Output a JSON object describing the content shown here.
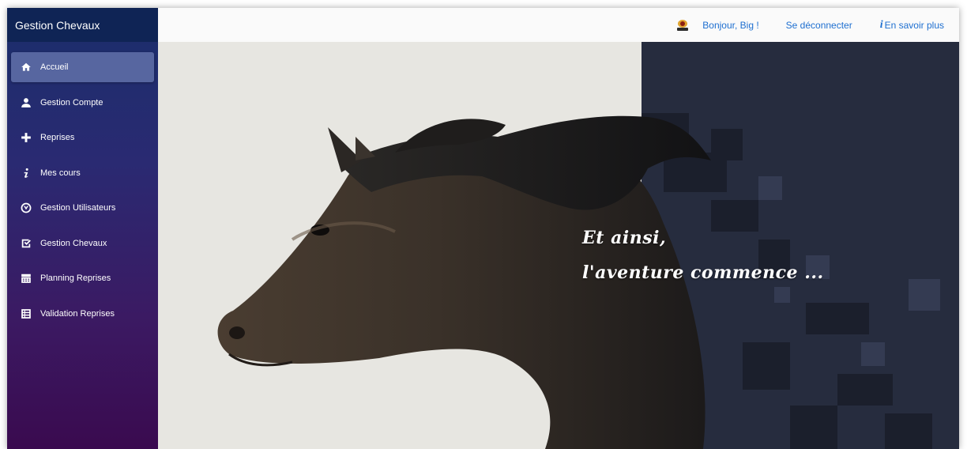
{
  "app": {
    "brand": "Gestion Chevaux"
  },
  "sidebar": {
    "items": [
      {
        "label": "Accueil",
        "icon": "home-icon",
        "active": true
      },
      {
        "label": "Gestion Compte",
        "icon": "person-icon",
        "active": false
      },
      {
        "label": "Reprises",
        "icon": "plus-icon",
        "active": false
      },
      {
        "label": "Mes cours",
        "icon": "info-icon",
        "active": false
      },
      {
        "label": "Gestion Utilisateurs",
        "icon": "compass-icon",
        "active": false
      },
      {
        "label": "Gestion Chevaux",
        "icon": "checkbox-icon",
        "active": false
      },
      {
        "label": "Planning Reprises",
        "icon": "calendar-icon",
        "active": false
      },
      {
        "label": "Validation Reprises",
        "icon": "list-icon",
        "active": false
      }
    ]
  },
  "topbar": {
    "avatar_icon": "user-avatar-icon",
    "greeting": "Bonjour, Big !",
    "logout": "Se déconnecter",
    "more_icon": "i",
    "more": "En savoir plus"
  },
  "hero": {
    "line1": "Et ainsi,",
    "line2": "l'aventure commence ..."
  },
  "colors": {
    "sidebar_top": "#1a2e6b",
    "sidebar_bottom": "#3a0a4f",
    "active_item": "#5766a0",
    "link": "#1e6fd0",
    "hero_background": "#e7e6e1",
    "hero_dark": "#262c3e"
  }
}
